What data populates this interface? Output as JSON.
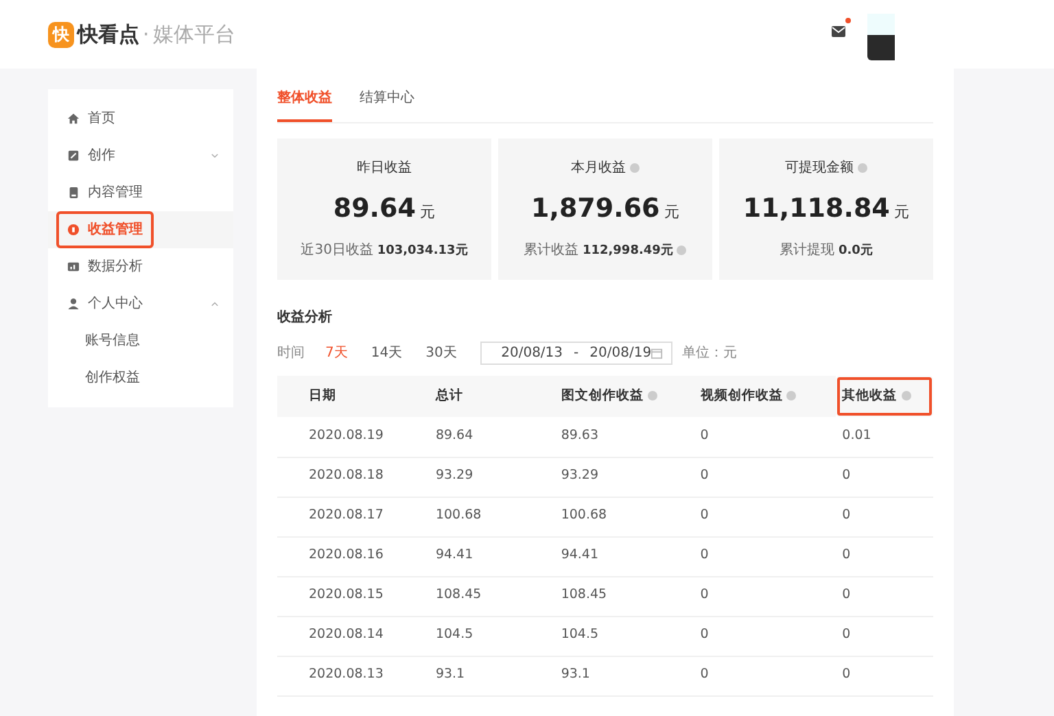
{
  "header": {
    "logo_mark": "快",
    "brand": "快看点",
    "separator": "·",
    "subtitle": "媒体平台",
    "mail_unread": true
  },
  "sidebar": {
    "items": [
      {
        "label": "首页",
        "selected": false,
        "highlighted": false
      },
      {
        "label": "创作",
        "selected": false,
        "highlighted": false,
        "expanded": false
      },
      {
        "label": "内容管理",
        "selected": false,
        "highlighted": false
      },
      {
        "label": "收益管理",
        "selected": true,
        "highlighted": true
      },
      {
        "label": "数据分析",
        "selected": false,
        "highlighted": false
      },
      {
        "label": "个人中心",
        "selected": false,
        "highlighted": false,
        "expanded": true,
        "children": [
          {
            "label": "账号信息",
            "selected": false
          },
          {
            "label": "创作权益",
            "selected": false
          }
        ]
      }
    ]
  },
  "tabs": [
    {
      "label": "整体收益",
      "selected": true
    },
    {
      "label": "结算中心",
      "selected": false
    }
  ],
  "cards": [
    {
      "title": "昨日收益",
      "info": false,
      "amount": "89.64",
      "unit": "元",
      "sub_label": "近30日收益",
      "sub_value": "103,034.13元",
      "sub_info": false
    },
    {
      "title": "本月收益",
      "info": true,
      "amount": "1,879.66",
      "unit": "元",
      "sub_label": "累计收益",
      "sub_value": "112,998.49元",
      "sub_info": true
    },
    {
      "title": "可提现金额",
      "info": true,
      "amount": "11,118.84",
      "unit": "元",
      "sub_label": "累计提现",
      "sub_value": "0.0元",
      "sub_info": false
    }
  ],
  "analysis": {
    "title": "收益分析",
    "time_label": "时间",
    "ranges": [
      {
        "label": "7天",
        "selected": true
      },
      {
        "label": "14天",
        "selected": false
      },
      {
        "label": "30天",
        "selected": false
      }
    ],
    "date_range": {
      "start": "20/08/13",
      "separator": "-",
      "end": "20/08/19"
    },
    "unit": "单位：元"
  },
  "table": {
    "columns": [
      {
        "label": "日期",
        "info": false,
        "highlighted": false
      },
      {
        "label": "总计",
        "info": false,
        "highlighted": false
      },
      {
        "label": "图文创作收益",
        "info": true,
        "highlighted": false
      },
      {
        "label": "视频创作收益",
        "info": true,
        "highlighted": false
      },
      {
        "label": "其他收益",
        "info": true,
        "highlighted": true
      }
    ],
    "rows": [
      [
        "2020.08.19",
        "89.64",
        "89.63",
        "0",
        "0.01"
      ],
      [
        "2020.08.18",
        "93.29",
        "93.29",
        "0",
        "0"
      ],
      [
        "2020.08.17",
        "100.68",
        "100.68",
        "0",
        "0"
      ],
      [
        "2020.08.16",
        "94.41",
        "94.41",
        "0",
        "0"
      ],
      [
        "2020.08.15",
        "108.45",
        "108.45",
        "0",
        "0"
      ],
      [
        "2020.08.14",
        "104.5",
        "104.5",
        "0",
        "0"
      ],
      [
        "2020.08.13",
        "93.1",
        "93.1",
        "0",
        "0"
      ]
    ]
  }
}
